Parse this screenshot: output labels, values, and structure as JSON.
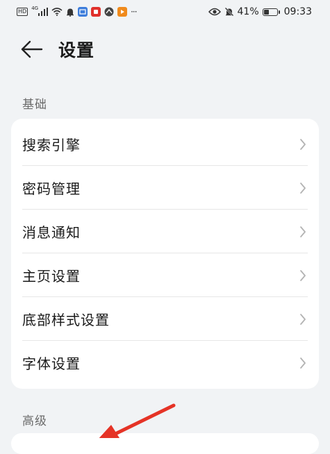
{
  "status_bar": {
    "left_icons": [
      "hd-icon",
      "signal-4g-icon",
      "wifi-icon",
      "notification-bell-icon",
      "app-badge-icon",
      "red-app-icon",
      "browser-app-icon",
      "orange-play-icon",
      "more-dots-icon"
    ],
    "hd_text": "HD",
    "network_text": "4G",
    "dots_text": "···",
    "battery_percent": "41%",
    "battery_level": 0.41,
    "time": "09:33"
  },
  "header": {
    "title": "设置"
  },
  "sections": [
    {
      "label": "基础",
      "items": [
        {
          "label": "搜索引擎"
        },
        {
          "label": "密码管理"
        },
        {
          "label": "消息通知"
        },
        {
          "label": "主页设置"
        },
        {
          "label": "底部样式设置"
        },
        {
          "label": "字体设置"
        }
      ]
    },
    {
      "label": "高级",
      "items": []
    }
  ],
  "colors": {
    "background": "#f1f3f5",
    "card": "#ffffff",
    "annotation_arrow": "#e53326",
    "chevron": "#b3b3b3"
  }
}
